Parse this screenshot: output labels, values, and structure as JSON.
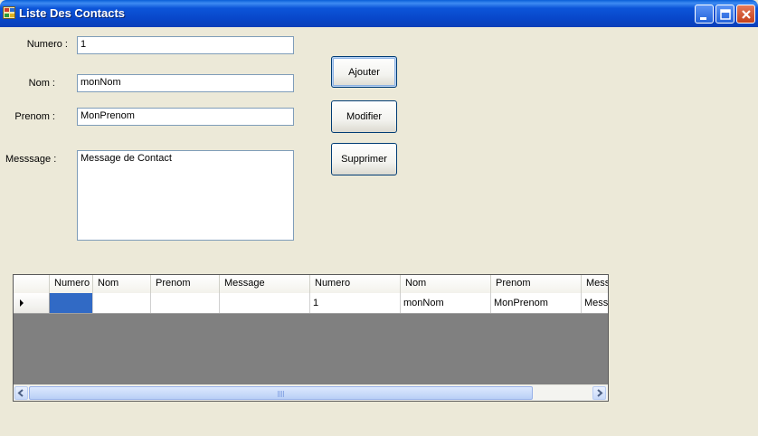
{
  "window": {
    "title": "Liste Des Contacts",
    "controls": {
      "minimize_icon": "minimize-icon",
      "maximize_icon": "maximize-icon",
      "close_icon": "close-icon"
    }
  },
  "form": {
    "numero": {
      "label": "Numero :",
      "value": "1"
    },
    "nom": {
      "label": "Nom :",
      "value": "monNom"
    },
    "prenom": {
      "label": "Prenom :",
      "value": "MonPrenom"
    },
    "message": {
      "label": "Messsage :",
      "value": "Message de Contact"
    }
  },
  "buttons": {
    "ajouter": "Ajouter",
    "modifier": "Modifier",
    "supprimer": "Supprimer"
  },
  "grid": {
    "columns": [
      "Numero",
      "Nom",
      "Prenom",
      "Message",
      "Numero",
      "Nom",
      "Prenom",
      "Mess"
    ],
    "rows": [
      [
        "",
        "",
        "",
        "",
        "1",
        "monNom",
        "MonPrenom",
        "Mess"
      ]
    ]
  },
  "colors": {
    "titlebar": "#0A4FD0",
    "form_bg": "#ECE9D8",
    "selection": "#316AC5",
    "grid_bg": "#808080"
  }
}
